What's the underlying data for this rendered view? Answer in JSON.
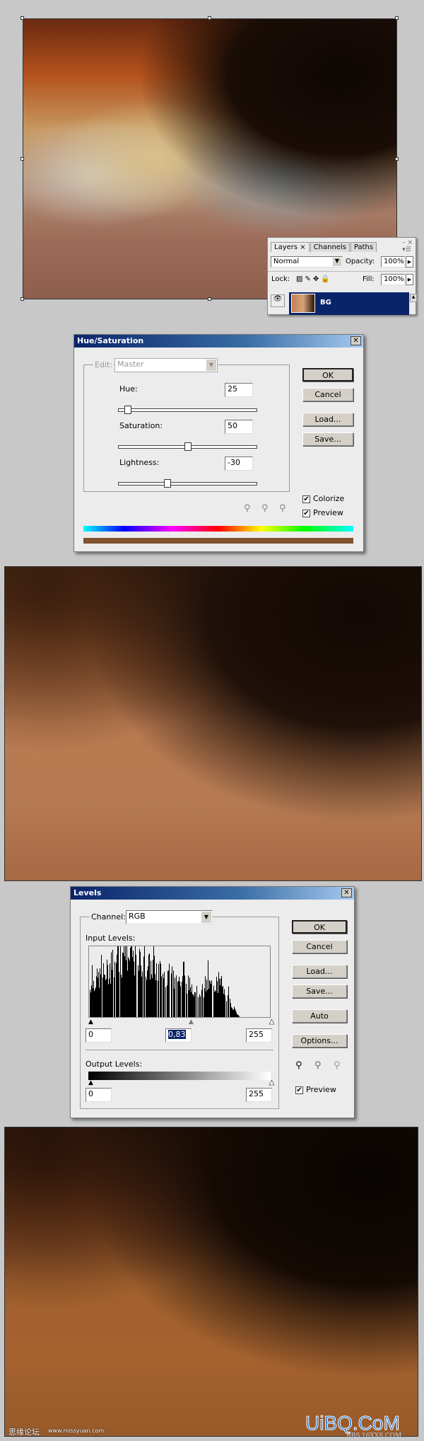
{
  "layers_panel": {
    "tabs": [
      "Layers",
      "Channels",
      "Paths"
    ],
    "blend_mode": "Normal",
    "opacity_label": "Opacity:",
    "opacity": "100%",
    "lock_label": "Lock:",
    "fill_label": "Fill:",
    "fill": "100%",
    "layer_name": "BG",
    "selected_color": "#0a246a"
  },
  "hue_saturation": {
    "title": "Hue/Saturation",
    "edit_label": "Edit:",
    "edit_value": "Master",
    "hue_label": "Hue:",
    "hue": "25",
    "saturation_label": "Saturation:",
    "saturation": "50",
    "lightness_label": "Lightness:",
    "lightness": "-30",
    "ok": "OK",
    "cancel": "Cancel",
    "load": "Load...",
    "save": "Save...",
    "colorize_label": "Colorize",
    "colorize": true,
    "preview_label": "Preview",
    "preview": true,
    "result_color": "#7f5230"
  },
  "levels": {
    "title": "Levels",
    "channel_label": "Channel:",
    "channel": "RGB",
    "input_label": "Input Levels:",
    "input_black": "0",
    "input_gamma": "0,83",
    "input_white": "255",
    "output_label": "Output Levels:",
    "output_black": "0",
    "output_white": "255",
    "ok": "OK",
    "cancel": "Cancel",
    "load": "Load...",
    "save": "Save...",
    "auto": "Auto",
    "options": "Options...",
    "preview_label": "Preview",
    "preview": true
  },
  "watermarks": {
    "forum": "思缘论坛",
    "url": "www.missyuan.com",
    "brand": "UiBQ.CoM",
    "brand_sub": "BBS.16XX8.COM"
  }
}
